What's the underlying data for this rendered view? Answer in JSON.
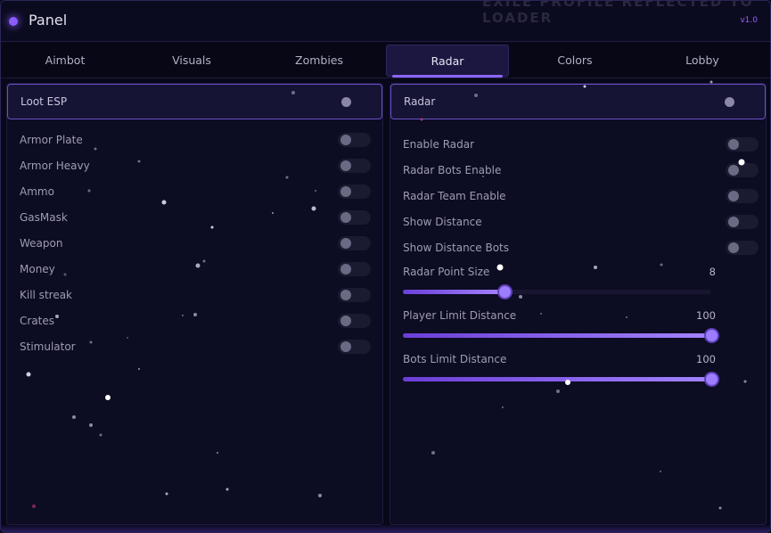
{
  "app": {
    "title": "Panel",
    "version": "v1.0",
    "ghost_title": "EXILE PROFILE REFLECTED TO LOADER"
  },
  "tabs": [
    {
      "label": "Aimbot",
      "active": false
    },
    {
      "label": "Visuals",
      "active": false
    },
    {
      "label": "Zombies",
      "active": false
    },
    {
      "label": "Radar",
      "active": true
    },
    {
      "label": "Colors",
      "active": false
    },
    {
      "label": "Lobby",
      "active": false
    }
  ],
  "loot_esp": {
    "title": "Loot ESP",
    "enabled": false,
    "items": [
      {
        "label": "Armor Plate",
        "on": false
      },
      {
        "label": "Armor Heavy",
        "on": false
      },
      {
        "label": "Ammo",
        "on": false
      },
      {
        "label": "GasMask",
        "on": false
      },
      {
        "label": "Weapon",
        "on": false
      },
      {
        "label": "Money",
        "on": false
      },
      {
        "label": "Kill streak",
        "on": false
      },
      {
        "label": "Crates",
        "on": false
      },
      {
        "label": "Stimulator",
        "on": false
      }
    ]
  },
  "radar": {
    "title": "Radar",
    "enabled": false,
    "toggles": [
      {
        "label": "Enable Radar",
        "on": false
      },
      {
        "label": "Radar Bots Enable",
        "on": false
      },
      {
        "label": "Radar Team Enable",
        "on": false
      },
      {
        "label": "Show Distance",
        "on": false
      },
      {
        "label": "Show Distance Bots",
        "on": false
      }
    ],
    "sliders": [
      {
        "label": "Radar Point Size",
        "value": "8",
        "fraction": 0.33
      },
      {
        "label": "Player Limit Distance",
        "value": "100",
        "fraction": 1.0
      },
      {
        "label": "Bots Limit Distance",
        "value": "100",
        "fraction": 1.0
      }
    ]
  },
  "colors": {
    "accent": "#8c5cff",
    "background": "#08081b",
    "panel": "#0c0c22"
  }
}
